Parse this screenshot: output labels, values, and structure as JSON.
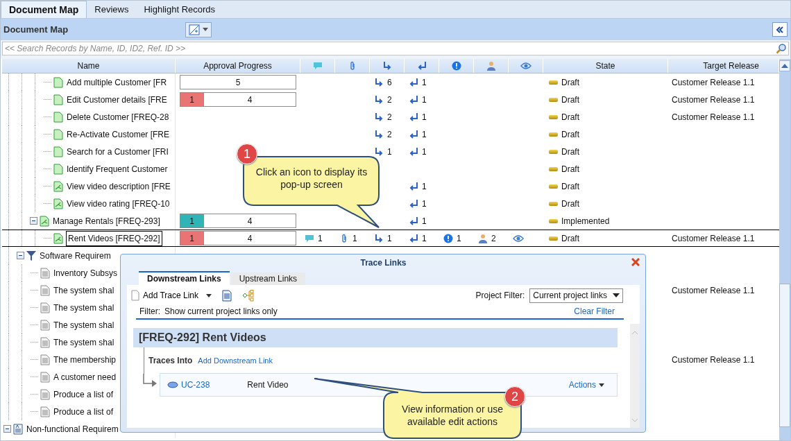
{
  "tabs": [
    {
      "label": "Document Map",
      "selected": true
    },
    {
      "label": "Reviews",
      "selected": false
    },
    {
      "label": "Highlight Records",
      "selected": false
    }
  ],
  "panel": {
    "title": "Document Map"
  },
  "search": {
    "placeholder": "<< Search Records by Name, ID, ID2, Ref. ID >>"
  },
  "table": {
    "columns": [
      {
        "kind": "text",
        "label": "Name"
      },
      {
        "kind": "text",
        "label": "Approval Progress"
      },
      {
        "kind": "comments"
      },
      {
        "kind": "attachments"
      },
      {
        "kind": "downstream"
      },
      {
        "kind": "upstream"
      },
      {
        "kind": "issues"
      },
      {
        "kind": "users"
      },
      {
        "kind": "watch"
      },
      {
        "kind": "text",
        "label": "State"
      },
      {
        "kind": "text",
        "label": "Target Release"
      }
    ],
    "rows": [
      {
        "children": [
          {
            "children": [
              {
                "children": [
                  {
                    "name": "Add multiple Customer [FR",
                    "kind": "requirement",
                    "selected": false,
                    "approval": [
                      {
                        "value": "5",
                        "color": "#ffffff"
                      }
                    ],
                    "counts": {
                      "downstream": "6",
                      "upstream": "1"
                    },
                    "watched": false,
                    "state": "Draft",
                    "target_release": "Customer Release 1.1"
                  },
                  {
                    "name": "Edit Customer details [FRE",
                    "kind": "requirement",
                    "selected": false,
                    "approval": [
                      {
                        "value": "1",
                        "color": "#e87474"
                      },
                      {
                        "value": "4",
                        "color": "#ffffff"
                      }
                    ],
                    "counts": {
                      "downstream": "2",
                      "upstream": "1"
                    },
                    "watched": false,
                    "state": "Draft",
                    "target_release": "Customer Release 1.1"
                  },
                  {
                    "name": "Delete Customer [FREQ-28",
                    "kind": "requirement",
                    "selected": false,
                    "counts": {
                      "downstream": "2",
                      "upstream": "1"
                    },
                    "watched": false,
                    "state": "Draft",
                    "target_release": "Customer Release 1.1"
                  },
                  {
                    "name": "Re-Activate Customer [FRE",
                    "kind": "requirement",
                    "selected": false,
                    "counts": {
                      "downstream": "2",
                      "upstream": "1"
                    },
                    "watched": false,
                    "state": "Draft"
                  },
                  {
                    "name": "Search for a Customer [FRI",
                    "kind": "requirement",
                    "selected": false,
                    "counts": {
                      "downstream": "1",
                      "upstream": "1"
                    },
                    "watched": false,
                    "state": "Draft"
                  },
                  {
                    "name": "Identify Frequent Customer",
                    "kind": "requirement",
                    "selected": false,
                    "watched": false,
                    "state": "Draft"
                  },
                  {
                    "name": "View video description [FRE",
                    "kind": "linked-requirement",
                    "selected": false,
                    "counts": {
                      "upstream": "1"
                    },
                    "watched": false,
                    "state": "Draft"
                  },
                  {
                    "name": "View video rating [FREQ-10",
                    "kind": "linked-requirement",
                    "selected": false,
                    "counts": {
                      "upstream": "1"
                    },
                    "watched": false,
                    "state": "Draft"
                  }
                ]
              },
              {
                "name": "Manage Rentals [FREQ-293]",
                "kind": "linked-requirement",
                "expanded": true,
                "selected": false,
                "approval": [
                  {
                    "value": "1",
                    "color": "#2fb5b5"
                  },
                  {
                    "value": "4",
                    "color": "#ffffff"
                  }
                ],
                "counts": {
                  "upstream": "1"
                },
                "watched": false,
                "state": "Implemented",
                "children": [
                  {
                    "name": "Rent Videos [FREQ-292]",
                    "kind": "linked-requirement",
                    "selected": true,
                    "approval": [
                      {
                        "value": "1",
                        "color": "#e87474"
                      },
                      {
                        "value": "4",
                        "color": "#ffffff"
                      }
                    ],
                    "counts": {
                      "comments": "1",
                      "attachments": "1",
                      "downstream": "1",
                      "upstream": "1",
                      "issues": "1",
                      "users": "2"
                    },
                    "watched": true,
                    "state": "Draft",
                    "target_release": "Customer Release 1.1"
                  }
                ]
              }
            ]
          },
          {
            "name": "Software Requirem",
            "kind": "filter-folder",
            "expanded": true,
            "selected": false,
            "watched": false,
            "children": [
              {
                "name": "Inventory Subsys",
                "kind": "text-document",
                "selected": false,
                "watched": false
              },
              {
                "name": "The system shal",
                "kind": "text-document",
                "selected": false,
                "watched": false,
                "target_release": "Customer Release 1.1"
              },
              {
                "name": "The system shal",
                "kind": "text-document",
                "selected": false,
                "watched": false
              },
              {
                "name": "The system shal",
                "kind": "text-document",
                "selected": false,
                "watched": false
              },
              {
                "name": "The system shal",
                "kind": "text-document",
                "selected": false,
                "watched": false
              },
              {
                "name": "The membership",
                "kind": "text-document",
                "selected": false,
                "watched": false,
                "target_release": "Customer Release 1.1"
              },
              {
                "name": "A customer need",
                "kind": "text-document",
                "selected": false,
                "watched": false
              },
              {
                "name": "Produce a list of",
                "kind": "text-document",
                "selected": false,
                "watched": false
              },
              {
                "name": "Produce a list of",
                "kind": "text-document",
                "selected": false,
                "watched": false
              }
            ]
          }
        ]
      },
      {
        "name": "Non-functional Requirem",
        "kind": "spec-document",
        "expanded": true,
        "selected": false,
        "watched": false
      }
    ]
  },
  "trace_links": {
    "title": "Trace Links",
    "tabs": [
      {
        "label": "Downstream Links",
        "selected": true
      },
      {
        "label": "Upstream Links",
        "selected": false
      }
    ],
    "add_label": "Add Trace Link",
    "project_filter": {
      "label": "Project Filter:",
      "value": "Current project links"
    },
    "filter": {
      "label": "Filter:",
      "text": "Show current project links only",
      "clear": "Clear Filter"
    },
    "record": {
      "title": "[FREQ-292] Rent Videos",
      "traces_label": "Traces Into",
      "add_link": "Add Downstream Link",
      "links": [
        {
          "id": "UC-238",
          "name": "Rent Video",
          "actions": "Actions"
        }
      ]
    }
  },
  "callouts": [
    {
      "number": "1",
      "text": "Click an icon to display its pop-up screen"
    },
    {
      "number": "2",
      "text": "View information or use available edit actions"
    }
  ]
}
